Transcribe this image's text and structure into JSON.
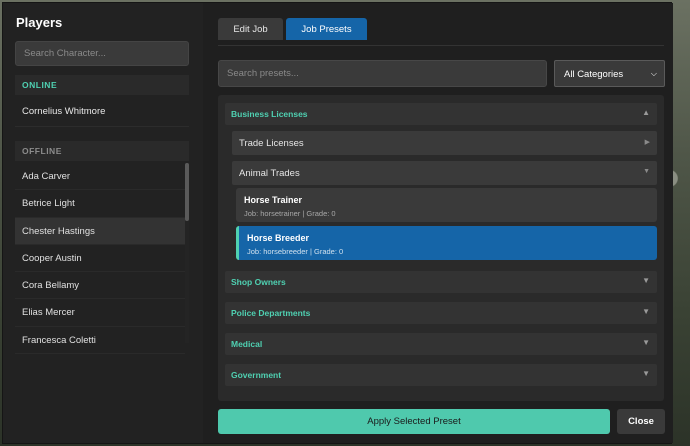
{
  "sidebar": {
    "title": "Players",
    "search_placeholder": "Search Character...",
    "online_label": "ONLINE",
    "online_players": [
      "Cornelius Whitmore"
    ],
    "offline_label": "OFFLINE",
    "offline_players": [
      "Ada Carver",
      "Betrice Light",
      "Chester Hastings",
      "Cooper Austin",
      "Cora Bellamy",
      "Elias Mercer",
      "Francesca Coletti"
    ],
    "selected_player": "Chester Hastings"
  },
  "tabs": {
    "edit_job": "Edit Job",
    "job_presets": "Job Presets",
    "active": "Job Presets"
  },
  "filters": {
    "search_placeholder": "Search presets...",
    "category_selected": "All Categories"
  },
  "categories": {
    "business": {
      "label": "Business Licenses",
      "arrow": "▲"
    },
    "trade": {
      "label": "Trade Licenses",
      "arrow": "▶"
    },
    "animal": {
      "label": "Animal Trades",
      "arrow": "▼"
    },
    "shop": {
      "label": "Shop Owners",
      "arrow": "▼"
    },
    "police": {
      "label": "Police Departments",
      "arrow": "▼"
    },
    "medical": {
      "label": "Medical",
      "arrow": "▼"
    },
    "government": {
      "label": "Government",
      "arrow": "▼"
    }
  },
  "presets": {
    "horse_trainer": {
      "name": "Horse Trainer",
      "meta": "Job: horsetrainer | Grade: 0"
    },
    "horse_breeder": {
      "name": "Horse Breeder",
      "meta": "Job: horsebreeder | Grade: 0"
    }
  },
  "actions": {
    "apply": "Apply Selected Preset",
    "close": "Close"
  },
  "colors": {
    "accent": "#4fd1b2",
    "primary": "#1565a8",
    "panel": "#1f1f1f"
  },
  "icons": {
    "dropdown": "chevron-down-icon",
    "expand": "triangle-icon"
  }
}
